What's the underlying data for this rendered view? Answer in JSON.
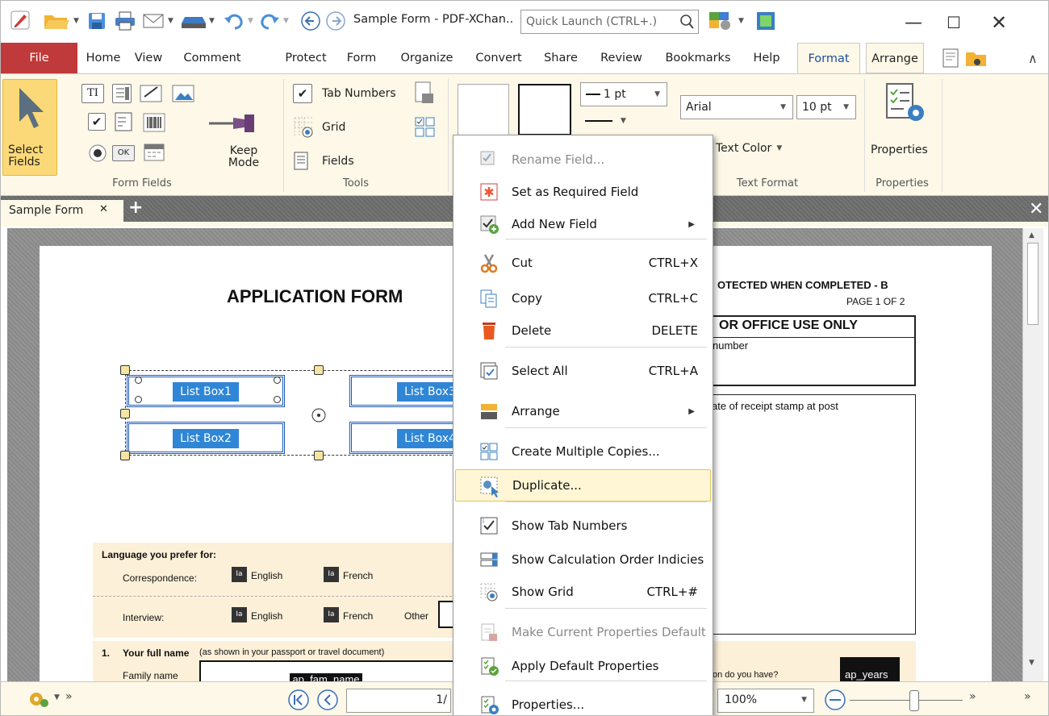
{
  "window": {
    "title": "Sample Form - PDF-XChan..",
    "quick_launch_placeholder": "Quick Launch (CTRL+.)"
  },
  "menu": [
    "File",
    "Home",
    "View",
    "Comment",
    "Protect",
    "Form",
    "Organize",
    "Convert",
    "Share",
    "Review",
    "Bookmarks",
    "Help",
    "Format",
    "Arrange"
  ],
  "ribbon": {
    "select_fields": "Select Fields",
    "keep_mode": "Keep Mode",
    "tab_numbers": "Tab Numbers",
    "grid": "Grid",
    "fields": "Fields",
    "line_width": "1 pt",
    "font": "Arial",
    "font_size": "10 pt",
    "text_color": "Text Color",
    "properties": "Properties",
    "groups": {
      "form_fields": "Form Fields",
      "tools": "Tools",
      "text_format": "Text Format",
      "properties": "Properties"
    }
  },
  "doc_tab": {
    "label": "Sample Form"
  },
  "document": {
    "title": "APPLICATION FORM",
    "protected": "OTECTED WHEN COMPLETED - B",
    "page_of": "PAGE 1 OF 2",
    "office_use": "OR OFFICE USE ONLY",
    "number": "number",
    "receipt": "ate of receipt stamp at post",
    "list_boxes": [
      "List Box1",
      "List Box3",
      "List Box2",
      "List Box4"
    ],
    "language_prefer": "Language you prefer for:",
    "correspondence": "Correspondence:",
    "interview": "Interview:",
    "english": "English",
    "french": "French",
    "other": "Other",
    "full_name_num": "1.",
    "full_name": "Your full name",
    "full_name_note": "(as shown in your passport or travel document)",
    "family_name": "Family name",
    "fam_name_field": "ap_fam_name",
    "do_you_have": "on do you have?",
    "years_field": "ap_years"
  },
  "context_menu": [
    {
      "label": "Rename Field...",
      "shortcut": "",
      "disabled": true,
      "submenu": false,
      "icon": "rename-field-icon"
    },
    {
      "label": "Set as Required Field",
      "shortcut": "",
      "disabled": false,
      "submenu": false,
      "icon": "required-field-icon"
    },
    {
      "label": "Add New Field",
      "shortcut": "",
      "disabled": false,
      "submenu": true,
      "icon": "add-field-icon"
    },
    {
      "label": "Cut",
      "shortcut": "CTRL+X",
      "disabled": false,
      "submenu": false,
      "icon": "scissors-icon"
    },
    {
      "label": "Copy",
      "shortcut": "CTRL+C",
      "disabled": false,
      "submenu": false,
      "icon": "copy-icon"
    },
    {
      "label": "Delete",
      "shortcut": "DELETE",
      "disabled": false,
      "submenu": false,
      "icon": "trash-icon"
    },
    {
      "label": "Select All",
      "shortcut": "CTRL+A",
      "disabled": false,
      "submenu": false,
      "icon": "select-all-icon"
    },
    {
      "label": "Arrange",
      "shortcut": "",
      "disabled": false,
      "submenu": true,
      "icon": "arrange-icon"
    },
    {
      "label": "Create Multiple Copies...",
      "shortcut": "",
      "disabled": false,
      "submenu": false,
      "icon": "multiple-copies-icon"
    },
    {
      "label": "Duplicate...",
      "shortcut": "",
      "disabled": false,
      "submenu": false,
      "icon": "duplicate-icon",
      "highlighted": true
    },
    {
      "label": "Show Tab Numbers",
      "shortcut": "",
      "disabled": false,
      "submenu": false,
      "icon": "tab-numbers-icon"
    },
    {
      "label": "Show Calculation Order Indicies",
      "shortcut": "",
      "disabled": false,
      "submenu": false,
      "icon": "calc-order-icon"
    },
    {
      "label": "Show Grid",
      "shortcut": "CTRL+#",
      "disabled": false,
      "submenu": false,
      "icon": "grid-icon"
    },
    {
      "label": "Make Current Properties Default",
      "shortcut": "",
      "disabled": true,
      "submenu": false,
      "icon": "make-default-icon"
    },
    {
      "label": "Apply Default Properties",
      "shortcut": "",
      "disabled": false,
      "submenu": false,
      "icon": "apply-default-icon"
    },
    {
      "label": "Properties...",
      "shortcut": "",
      "disabled": false,
      "submenu": false,
      "icon": "properties-icon"
    }
  ],
  "status": {
    "page_field": "1/",
    "zoom": "100%"
  },
  "colors": {
    "file_tab": "#c0393b",
    "ribbon_bg": "#fdf8e7",
    "selection_blue": "#2f86d6",
    "highlight": "#fff6d5"
  }
}
